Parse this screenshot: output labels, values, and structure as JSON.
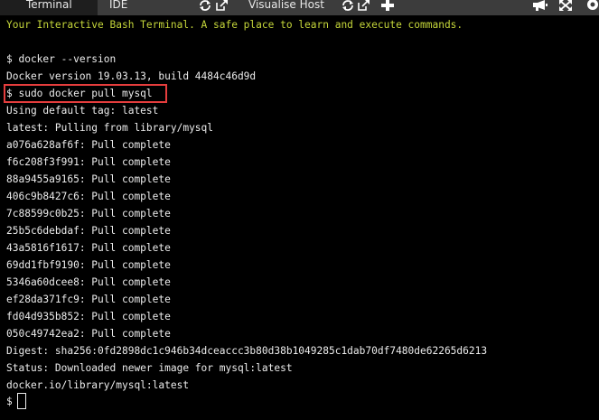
{
  "tabs": {
    "terminal": "Terminal",
    "ide": "IDE",
    "visualise_host": "Visualise Host"
  },
  "toolbar_icons": [
    "refresh-icon",
    "open-external-icon",
    "refresh-icon",
    "open-external-icon",
    "add-icon",
    "announcement-icon",
    "fullscreen-icon",
    "settings-icon"
  ],
  "colors": {
    "banner": "#c5d63a",
    "text": "#ececec",
    "background": "#000000",
    "highlight_border": "#e53d3d",
    "tabbar": "#3c3c3c",
    "active_tab": "#1e1e1e"
  },
  "terminal": {
    "banner": "Your Interactive Bash Terminal. A safe place to learn and execute commands.",
    "lines": [
      "$ docker --version",
      "Docker version 19.03.13, build 4484c46d9d",
      "$ sudo docker pull mysql",
      "Using default tag: latest",
      "latest: Pulling from library/mysql",
      "a076a628af6f: Pull complete",
      "f6c208f3f991: Pull complete",
      "88a9455a9165: Pull complete",
      "406c9b8427c6: Pull complete",
      "7c88599c0b25: Pull complete",
      "25b5c6debdaf: Pull complete",
      "43a5816f1617: Pull complete",
      "69dd1fbf9190: Pull complete",
      "5346a60dcee8: Pull complete",
      "ef28da371fc9: Pull complete",
      "fd04d935b852: Pull complete",
      "050c49742ea2: Pull complete",
      "Digest: sha256:0fd2898dc1c946b34dceaccc3b80d38b1049285c1dab70df7480de62265d6213",
      "Status: Downloaded newer image for mysql:latest",
      "docker.io/library/mysql:latest"
    ],
    "prompt": "$"
  }
}
